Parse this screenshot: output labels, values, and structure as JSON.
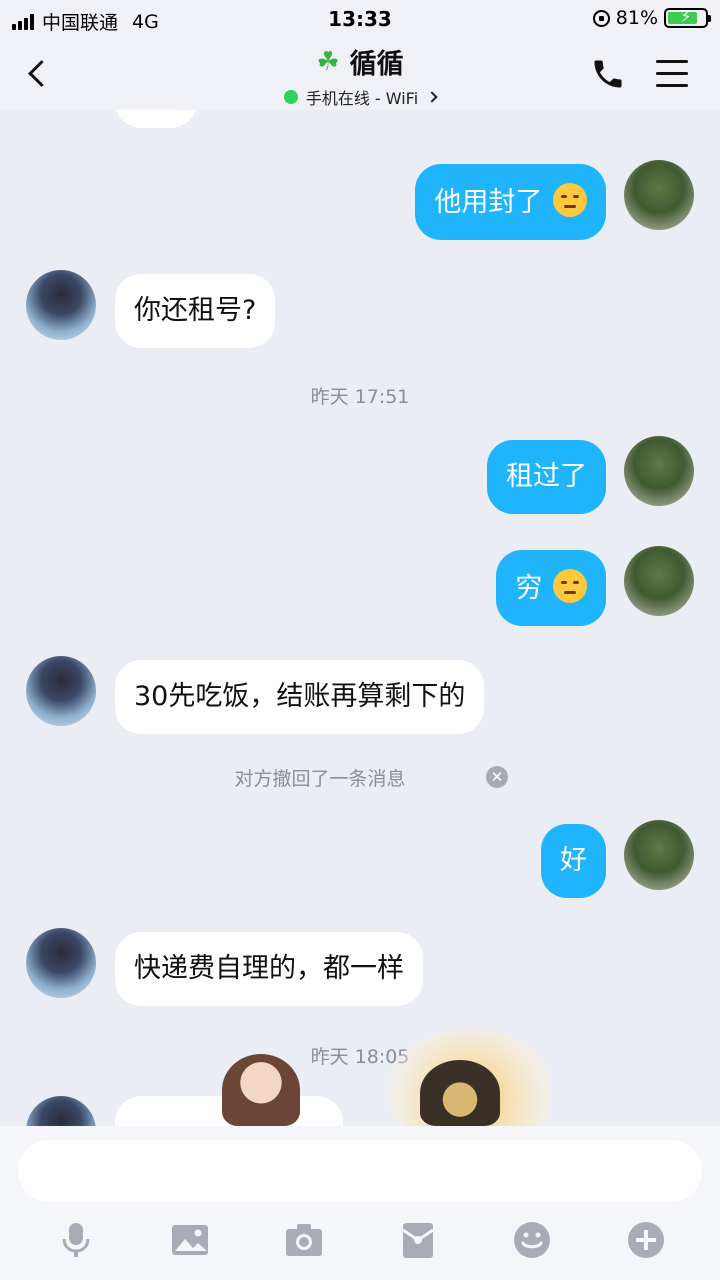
{
  "status_bar": {
    "carrier": "中国联通",
    "network": "4G",
    "time": "13:33",
    "battery": "81%",
    "battery_level": 0.81
  },
  "header": {
    "title": "循循",
    "status": "手机在线 - WiFi"
  },
  "chat": {
    "messages": [
      {
        "text": "他用封了"
      },
      {
        "text": "你还租号?"
      },
      {
        "text": "租过了"
      },
      {
        "text": "穷"
      },
      {
        "text": "30先吃饭，结账再算剩下的"
      },
      {
        "text": "好"
      },
      {
        "text": "快递费自理的，都一样"
      }
    ],
    "timestamps": [
      "昨天 17:51",
      "昨天 18:05"
    ],
    "recall_notice": "对方撤回了一条消息"
  },
  "input": {
    "placeholder": ""
  },
  "colors": {
    "outgoing_bubble": "#1fb4fb",
    "incoming_bubble": "#ffffff",
    "online": "#2fd35a"
  },
  "icons": [
    "mic-icon",
    "image-icon",
    "camera-icon",
    "red-packet-icon",
    "emoji-icon",
    "plus-icon"
  ]
}
